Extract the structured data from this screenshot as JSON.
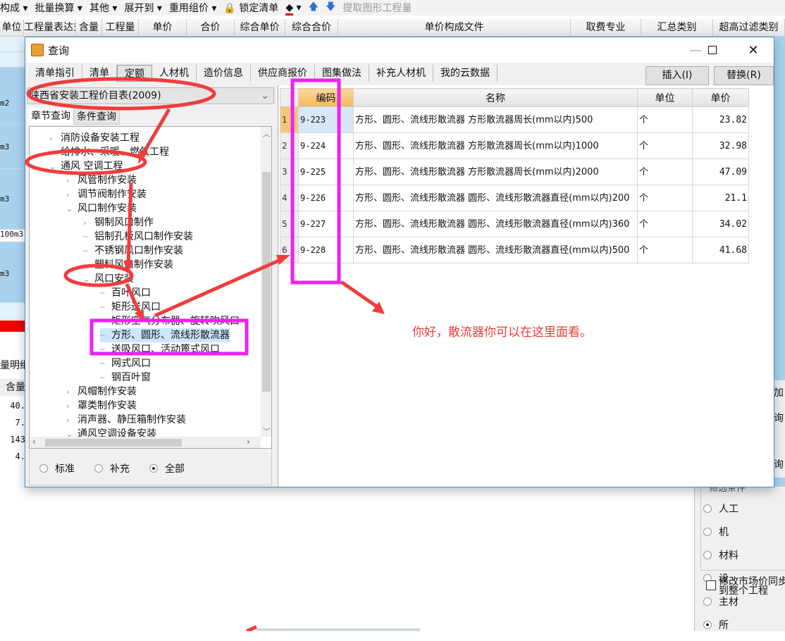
{
  "toolbar": {
    "items": [
      "构成 ▾",
      "批量换算 ▾",
      "其他 ▾",
      "展开到 ▾",
      "重用组价 ▾",
      "锁定清单",
      "▾",
      "提取图形工程量"
    ]
  },
  "columns": [
    "单位",
    "工程量表达式",
    "含量",
    "工程量",
    "单价",
    "合价",
    "综合单价",
    "综合合价",
    "单价构成文件",
    "取费专业",
    "汇总类别",
    "超高过滤类别"
  ],
  "background": {
    "units": [
      "m2",
      "m3",
      "m3",
      "100m3",
      "m3"
    ],
    "detail_label": "量明细",
    "content_header": "含量",
    "content_values": [
      "40.",
      "7.",
      "143",
      "4."
    ],
    "right_labels": [
      "加",
      "询",
      "询"
    ]
  },
  "dialog": {
    "title": "查询",
    "tabs": [
      "清单指引",
      "清单",
      "定额",
      "人材机",
      "造价信息",
      "供应商报价",
      "图集做法",
      "补充人材机",
      "我的云数据"
    ],
    "active_tab": "定额",
    "insert_button": "插入(I)",
    "replace_button": "替换(R)",
    "library": "陕西省安装工程价目表(2009)",
    "left_tabs": [
      "章节查询",
      "条件查询"
    ],
    "tree": [
      {
        "label": "消防设备安装工程",
        "level": 0,
        "state": "collapsed"
      },
      {
        "label": "给排水、采暖、燃气工程",
        "level": 0,
        "state": "collapsed"
      },
      {
        "label": "通风 空调工程",
        "level": 0,
        "state": "expanded"
      },
      {
        "label": "风管制作安装",
        "level": 1,
        "state": "collapsed"
      },
      {
        "label": "调节阀制作安装",
        "level": 1,
        "state": "collapsed"
      },
      {
        "label": "风口制作安装",
        "level": 1,
        "state": "expanded"
      },
      {
        "label": "钢制风口制作",
        "level": 2,
        "state": "collapsed"
      },
      {
        "label": "铝制孔板风口制作安装",
        "level": 2,
        "state": "leaf"
      },
      {
        "label": "不锈钢风口制作安装",
        "level": 2,
        "state": "leaf"
      },
      {
        "label": "塑料风口制作安装",
        "level": 2,
        "state": "collapsed"
      },
      {
        "label": "风口安装",
        "level": 2,
        "state": "expanded"
      },
      {
        "label": "百叶风口",
        "level": 3,
        "state": "leaf"
      },
      {
        "label": "矩形送风口",
        "level": 3,
        "state": "leaf"
      },
      {
        "label": "矩形空气分布器、旋转吹风口",
        "level": 3,
        "state": "leaf"
      },
      {
        "label": "方形、圆形、流线形散流器",
        "level": 3,
        "state": "leaf",
        "selected": true
      },
      {
        "label": "送吸风口、活动篦式风口",
        "level": 3,
        "state": "leaf"
      },
      {
        "label": "网式风口",
        "level": 3,
        "state": "leaf"
      },
      {
        "label": "钢百叶窗",
        "level": 3,
        "state": "leaf"
      },
      {
        "label": "风帽制作安装",
        "level": 1,
        "state": "collapsed"
      },
      {
        "label": "罩类制作安装",
        "level": 1,
        "state": "collapsed"
      },
      {
        "label": "消声器、静压箱制作安装",
        "level": 1,
        "state": "collapsed"
      },
      {
        "label": "通风空调设备安装",
        "level": 1,
        "state": "expanded"
      }
    ],
    "filter_radios": [
      {
        "label": "标准",
        "checked": false
      },
      {
        "label": "补充",
        "checked": false
      },
      {
        "label": "全部",
        "checked": true
      }
    ],
    "table": {
      "headers": [
        "编码",
        "名称",
        "单位",
        "单价"
      ],
      "rows": [
        {
          "no": "1",
          "code": "9-223",
          "name": "方形、圆形、流线形散流器 方形散流器周长(mm以内)500",
          "unit": "个",
          "price": "23.82"
        },
        {
          "no": "2",
          "code": "9-224",
          "name": "方形、圆形、流线形散流器 方形散流器周长(mm以内)1000",
          "unit": "个",
          "price": "32.98"
        },
        {
          "no": "3",
          "code": "9-225",
          "name": "方形、圆形、流线形散流器 方形散流器周长(mm以内)2000",
          "unit": "个",
          "price": "47.09"
        },
        {
          "no": "4",
          "code": "9-226",
          "name": "方形、圆形、流线形散流器 圆形、流线形散流器直径(mm以内)200",
          "unit": "个",
          "price": "21.1"
        },
        {
          "no": "5",
          "code": "9-227",
          "name": "方形、圆形、流线形散流器 圆形、流线形散流器直径(mm以内)360",
          "unit": "个",
          "price": "34.02"
        },
        {
          "no": "6",
          "code": "9-228",
          "name": "方形、圆形、流线形散流器 圆形、流线形散流器直径(mm以内)500",
          "unit": "个",
          "price": "41.68"
        }
      ]
    }
  },
  "side_panel": {
    "group_label": "筛选条件",
    "radios": [
      {
        "label": "人工",
        "checked": false
      },
      {
        "label": "机",
        "checked": false
      },
      {
        "label": "材料",
        "checked": false
      },
      {
        "label": "设",
        "checked": false
      },
      {
        "label": "主材",
        "checked": false
      },
      {
        "label": "所",
        "checked": true
      }
    ],
    "checkbox_label": "修改市场价同步到整个工程"
  },
  "annotation": {
    "note": "你好，散流器你可以在这里面看。",
    "note_color": "#ee3a3a",
    "ellipse_color": "#f03c3c",
    "box_color": "#ee22ee"
  }
}
